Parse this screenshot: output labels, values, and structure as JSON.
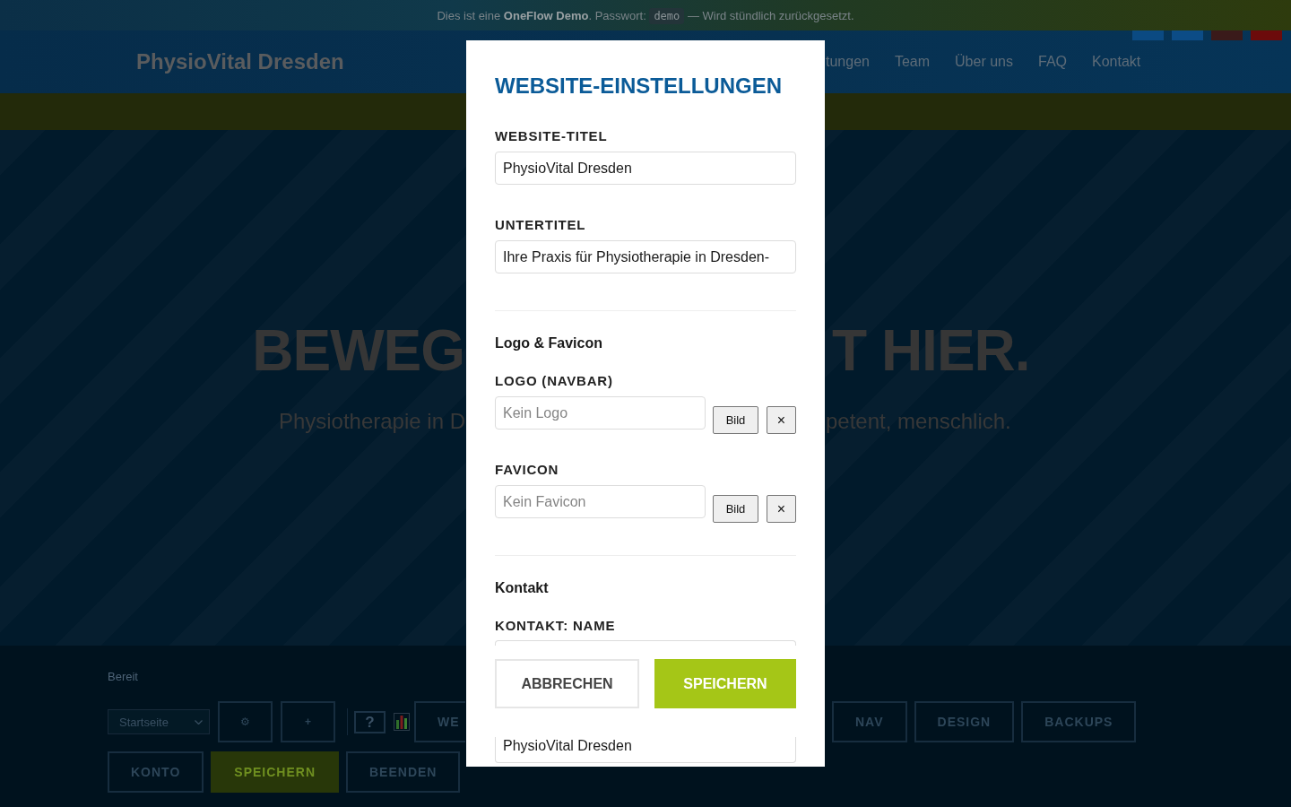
{
  "demo_banner": {
    "text": "Dies ist eine **OneFlow Demo**. Passwort:",
    "code": "demo",
    "note": "— Wird stündlich zurückgesetzt."
  },
  "navbar": {
    "brand": "PhysioVital Dresden",
    "links": [
      {
        "label": "tungen"
      },
      {
        "label": "Team"
      },
      {
        "label": "Über uns"
      },
      {
        "label": "FAQ"
      },
      {
        "label": "Kontakt"
      }
    ],
    "corner_tiles": [
      {
        "color": "#0b4a82"
      },
      {
        "color": "#0c4c86"
      },
      {
        "color": "#3a1a1a"
      },
      {
        "color": "#6c0b0b"
      }
    ]
  },
  "hero": {
    "heading_left": "BEWEG",
    "heading_right": "T HIER.",
    "subtitle_left": "Physiotherapie in D",
    "subtitle_right": "petent, menschlich."
  },
  "admin_bar": {
    "status": "Bereit",
    "page_select": "Startseite",
    "tools": [
      {
        "kind": "glyph",
        "label": "⚙"
      },
      {
        "kind": "glyph",
        "label": "+"
      },
      {
        "kind": "help",
        "label": "?"
      },
      {
        "kind": "chart"
      }
    ],
    "cut_off_button": {
      "label": "WE"
    },
    "right_buttons": [
      {
        "label": "NAV"
      },
      {
        "label": "DESIGN"
      },
      {
        "label": "BACKUPS"
      }
    ],
    "actions": [
      {
        "label": "KONTO",
        "primary": false
      },
      {
        "label": "SPEICHERN",
        "primary": true
      },
      {
        "label": "BEENDEN",
        "primary": false
      }
    ]
  },
  "dialog": {
    "title": "WEBSITE-EINSTELLUNGEN",
    "items": [
      {
        "kind": "field",
        "label": "WEBSITE-TITEL",
        "value": "PhysioVital Dresden"
      },
      {
        "kind": "field",
        "label": "UNTERTITEL",
        "value": "Ihre Praxis für Physiotherapie in Dresden-"
      },
      {
        "kind": "divider"
      },
      {
        "kind": "heading",
        "label": "Logo & Favicon"
      },
      {
        "kind": "image",
        "label": "LOGO (NAVBAR)",
        "placeholder": "Kein Logo",
        "pick_label": "Bild",
        "clear_label": "×"
      },
      {
        "kind": "image",
        "label": "FAVICON",
        "placeholder": "Kein Favicon",
        "pick_label": "Bild",
        "clear_label": "×"
      },
      {
        "kind": "divider"
      },
      {
        "kind": "heading",
        "label": "Kontakt"
      },
      {
        "kind": "covered",
        "label": "KONTAKT: NAME",
        "value": "PhysioVital Dresden"
      }
    ],
    "buttons": [
      {
        "label": "ABBRECHEN",
        "primary": false
      },
      {
        "label": "SPEICHERN",
        "primary": true
      }
    ]
  }
}
